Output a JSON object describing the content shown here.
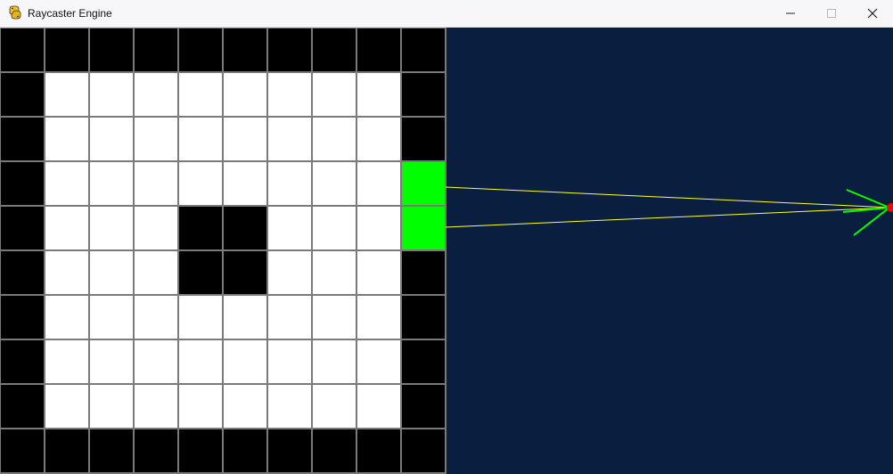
{
  "window": {
    "title": "Raycaster Engine",
    "app_icon": "python-snake-icon",
    "controls": {
      "minimize_icon": "minimize-icon",
      "maximize_icon": "maximize-icon",
      "close_icon": "close-icon"
    }
  },
  "map": {
    "rows": 10,
    "cols": 10,
    "grid": [
      "WWWWWWWWWW",
      "W........W",
      "W........W",
      "W........G",
      "W...WW...G",
      "W...WW...W",
      "W........W",
      "W........W",
      "W........W",
      "WWWWWWWWWW"
    ],
    "colors": {
      "wall": "#000000",
      "floor": "#ffffff",
      "hit": "#00ff00",
      "grid_line": "#7a7a7a"
    }
  },
  "view": {
    "background": "#0a1f3f",
    "ray_color": "#ffff33",
    "direction_color": "#00ff00",
    "player_color": "#ff0000"
  }
}
